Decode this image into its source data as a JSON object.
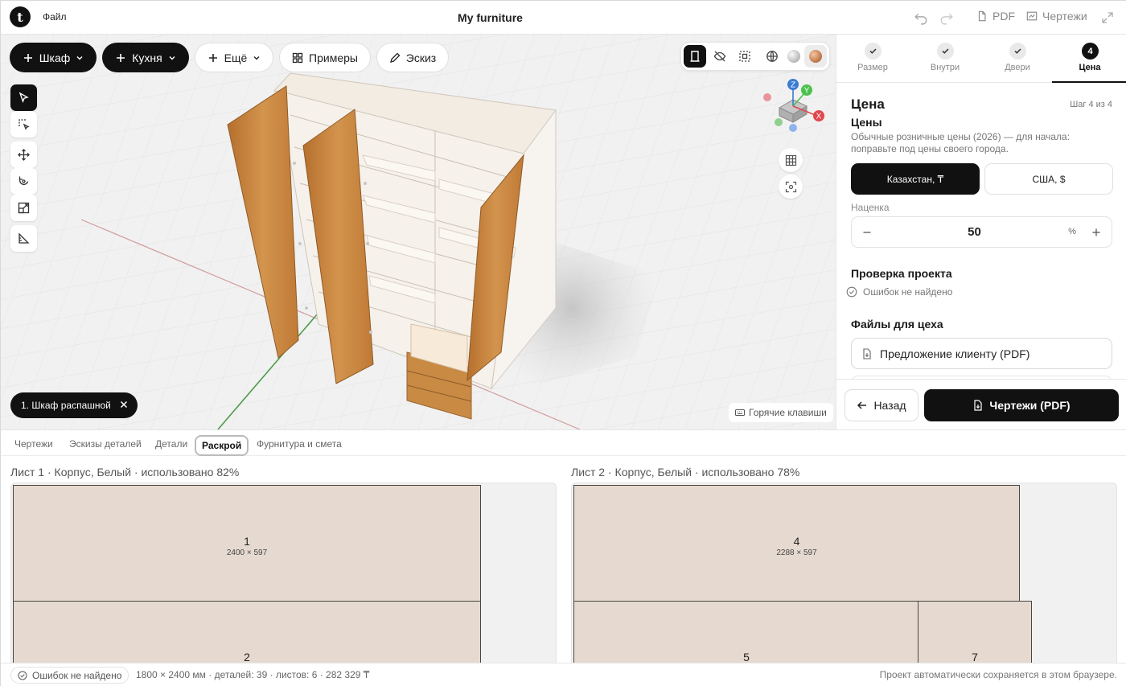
{
  "header": {
    "logo_letter": "t",
    "file_menu": "Файл",
    "title": "My furniture",
    "pdf_label": "PDF",
    "drawings_label": "Чертежи"
  },
  "toolbar": {
    "wardrobe": "Шкаф",
    "kitchen": "Кухня",
    "more": "Ещё",
    "examples": "Примеры",
    "sketch": "Эскиз"
  },
  "view_toolbar": {
    "items": [
      "door-view-icon",
      "hide-icon",
      "select-area-icon",
      "globe-icon",
      "material-grey",
      "material-wood"
    ],
    "active": "door-view-icon",
    "material_colors": {
      "grey": "#c9c9c9",
      "wood": "#c0703a"
    }
  },
  "left_tools": [
    "select-pointer-icon",
    "box-select-icon",
    "move-icon",
    "rotate-icon",
    "scale-icon",
    "measure-icon"
  ],
  "gizmo": {
    "z": "Z",
    "y": "Y",
    "x": "X"
  },
  "selection_chip": "1. Шкаф распашной",
  "hotkeys": "Горячие клавиши",
  "steps": [
    {
      "label": "Размер",
      "state": "done"
    },
    {
      "label": "Внутри",
      "state": "done"
    },
    {
      "label": "Двери",
      "state": "done"
    },
    {
      "label": "Цена",
      "state": "active",
      "number": "4"
    }
  ],
  "price_panel": {
    "title": "Цена",
    "step_counter": "Шаг 4 из 4",
    "prices_heading": "Цены",
    "prices_description": "Обычные розничные цены (2026) — для начала: поправьте под цены своего города.",
    "regions": [
      "Казахстан, ₸",
      "США, $"
    ],
    "selected_region": "Казахстан, ₸",
    "markup_label": "Наценка",
    "markup_value": "50",
    "markup_unit": "%",
    "check_heading": "Проверка проекта",
    "check_status": "Ошибок не найдено",
    "files_heading": "Файлы для цеха",
    "file_offer": "Предложение клиенту (PDF)",
    "back": "Назад",
    "drawings_pdf": "Чертежи (PDF)"
  },
  "bottom_tabs": [
    "Чертежи",
    "Эскизы деталей",
    "Детали",
    "Раскрой",
    "Фурнитура и смета"
  ],
  "active_tab": "Раскрой",
  "sheets": [
    {
      "title": "Лист 1 · Корпус, Белый · использовано 82%",
      "used_percent": 82,
      "parts": [
        {
          "num": "1",
          "dims": "2400 × 597"
        },
        {
          "num": "2",
          "dims": ""
        }
      ]
    },
    {
      "title": "Лист 2 · Корпус, Белый · использовано 78%",
      "used_percent": 78,
      "parts": [
        {
          "num": "4",
          "dims": "2288 × 597"
        },
        {
          "num": "5",
          "dims": ""
        },
        {
          "num": "7",
          "dims": ""
        }
      ]
    }
  ],
  "status": {
    "check": "Ошибок не найдено",
    "stats": "1800 × 2400 мм · деталей: 39 · листов: 6 · 282 329 ₸",
    "autosave": "Проект автоматически сохраняется в этом браузере."
  },
  "colors": {
    "accent": "#111111",
    "part_fill": "#e6dad0",
    "wood": "#c98a43",
    "axis_x": "#e0474c",
    "axis_y": "#4cc24c",
    "axis_z": "#3a7bd5"
  }
}
